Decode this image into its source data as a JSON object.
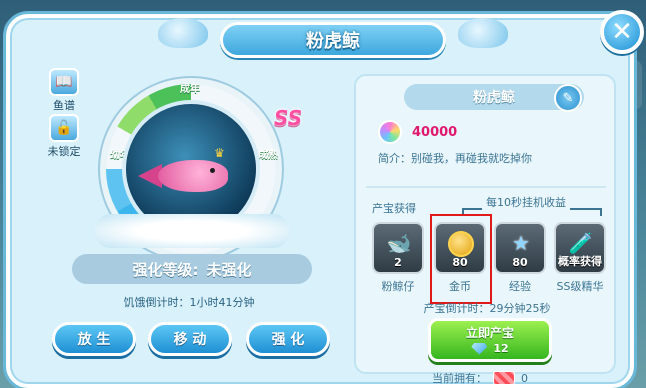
{
  "dialog": {
    "title": "粉虎鲸",
    "close_label": "✕"
  },
  "left": {
    "side_buttons": [
      {
        "label": "鱼谱",
        "icon": "book-icon"
      },
      {
        "label": "未锁定",
        "icon": "unlock-icon"
      }
    ],
    "ring_labels": {
      "top": "成年",
      "left": "幼年",
      "right": "成熟"
    },
    "rarity_badge": "SS",
    "enhance_label": "强化等级:",
    "enhance_value": "未强化",
    "hunger_text": "饥饿倒计时：1小时41分钟",
    "actions": [
      "放 生",
      "移 动",
      "强 化"
    ]
  },
  "right": {
    "name": "粉虎鲸",
    "price": "40000",
    "intro": "简介：别碰我，再碰我就吃掉你",
    "section_treasure": "产宝获得",
    "section_income": "每10秒挂机收益",
    "slots": [
      {
        "count": "2",
        "name": "粉鲸仔",
        "icon": "pink-whale-icon"
      },
      {
        "count": "80",
        "name": "金币",
        "icon": "gold-coin-icon"
      },
      {
        "count": "80",
        "name": "经验",
        "icon": "star-icon"
      },
      {
        "count": "概率获得",
        "name": "SS级精华",
        "icon": "essence-bottle-icon"
      }
    ],
    "countdown": "产宝倒计时：29分钟25秒",
    "produce_button": "立即产宝",
    "produce_cost": "12",
    "owned_label": "当前拥有：",
    "owned_value": "0"
  },
  "colors": {
    "accent_blue": "#1f8fd3",
    "produce_green": "#35b61f",
    "price_pink": "#e0196f",
    "highlight_red": "#e01a1a"
  }
}
